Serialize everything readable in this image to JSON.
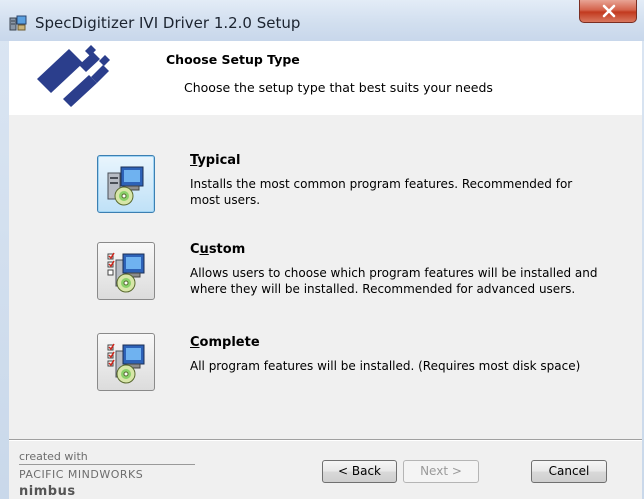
{
  "window": {
    "title": "SpecDigitizer IVI Driver 1.2.0 Setup"
  },
  "banner": {
    "title": "Choose Setup Type",
    "subtitle": "Choose the setup type that best suits your needs"
  },
  "options": [
    {
      "title_key": "T",
      "title_rest": "ypical",
      "description": "Installs the most common program features. Recommended for most users.",
      "icon": "typical-setup-icon",
      "focused": true
    },
    {
      "title_pre": "C",
      "title_key": "u",
      "title_rest": "stom",
      "description": "Allows users to choose which program features will be installed and where they will be installed. Recommended for advanced users.",
      "icon": "custom-setup-icon",
      "focused": false
    },
    {
      "title_key": "C",
      "title_rest": "omplete",
      "description": "All program features will be installed.  (Requires most disk space)",
      "icon": "complete-setup-icon",
      "focused": false
    }
  ],
  "footer": {
    "credit_line1": "created with",
    "credit_line2": "PACIFIC MINDWORKS",
    "credit_line3": "nimbus",
    "back_label": "< Back",
    "next_label": "Next >",
    "cancel_label": "Cancel",
    "next_enabled": false
  },
  "colors": {
    "accent": "#3c7fb1",
    "title_bar": "#d2dfef",
    "close_button": "#c23a1f",
    "logo_blue": "#2b3e8c"
  }
}
